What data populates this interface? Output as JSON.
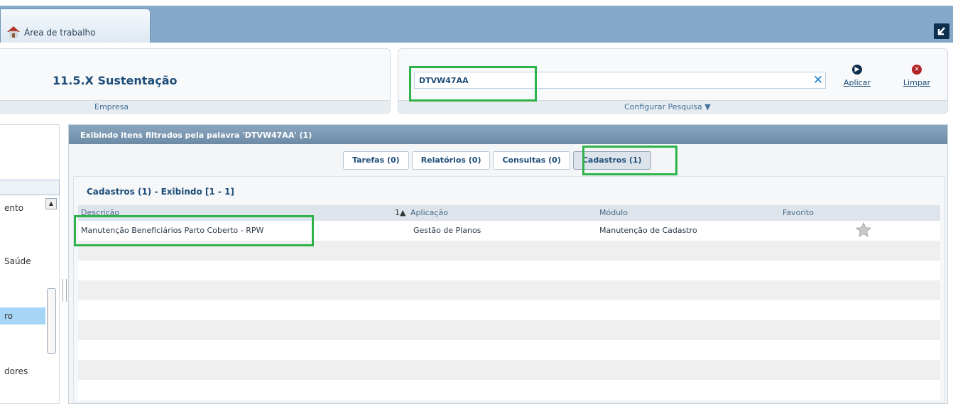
{
  "topbar": {
    "tab_label": "Área de trabalho",
    "minimize_icon": "collapse-arrow-icon"
  },
  "company": {
    "name": "11.5.X Sustentação",
    "label": "Empresa"
  },
  "search": {
    "value": "DTVW47AA",
    "apply_label": "Aplicar",
    "clear_label": "Limpar",
    "config_label": "Configurar Pesquisa ▼"
  },
  "sidebar": {
    "items": [
      "ento",
      "Saúde",
      "ro",
      "dores"
    ]
  },
  "main": {
    "title": "Exibindo itens filtrados pela palavra 'DTVW47AA' (1)",
    "tabs": [
      {
        "label": "Tarefas (0)"
      },
      {
        "label": "Relatórios (0)"
      },
      {
        "label": "Consultas (0)"
      },
      {
        "label": "Cadastros (1)"
      }
    ],
    "active_tab": "Cadastros (1)",
    "results_title": "Cadastros (1) - Exibindo [1 - 1]",
    "columns": {
      "descricao": "Descrição",
      "sort": "1▲",
      "aplicacao": "Aplicação",
      "modulo": "Módulo",
      "favorito": "Favorito"
    },
    "rows": [
      {
        "descricao": "Manutenção Beneficiários Parto Coberto - RPW",
        "aplicacao": "Gestão de Planos",
        "modulo": "Manutenção de Cadastro",
        "favorito_icon": "star-icon"
      }
    ]
  },
  "colors": {
    "topbar": "#87a9c9",
    "highlight": "#2eb34a",
    "accent": "#1f4e79"
  }
}
